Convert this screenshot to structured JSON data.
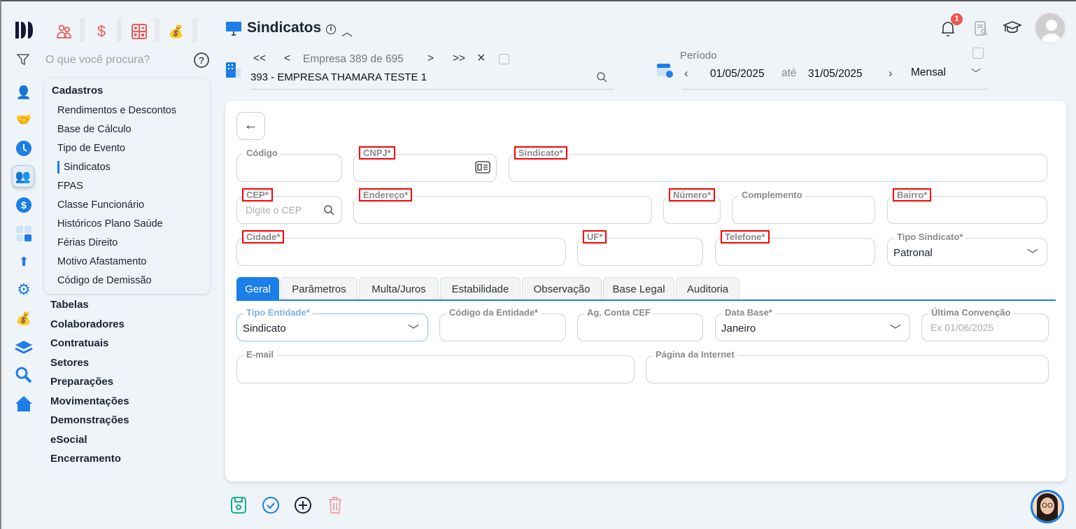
{
  "app": {
    "logo": "logo-mark"
  },
  "top_modules": [
    {
      "icon": "people-icon"
    },
    {
      "icon": "dollar-icon"
    },
    {
      "icon": "calculator-icon"
    },
    {
      "icon": "money-bag-icon"
    }
  ],
  "search": {
    "placeholder": "O que você procura?"
  },
  "page": {
    "title": "Sindicatos"
  },
  "company_nav": {
    "first": "<<",
    "prev": "<",
    "label": "Empresa 389 de 695",
    "next": ">",
    "last": ">>",
    "close": "×",
    "company": "393 - EMPRESA THAMARA TESTE 1"
  },
  "period": {
    "label": "Período",
    "start": "01/05/2025",
    "until": "até",
    "end": "31/05/2025",
    "type": "Mensal"
  },
  "notifications": {
    "count": "1"
  },
  "submenu": {
    "title": "Cadastros",
    "items": [
      "Rendimentos e Descontos",
      "Base de Cálculo",
      "Tipo de Evento",
      "Sindicatos",
      "FPAS",
      "Classe Funcionário",
      "Históricos Plano Saúde",
      "Férias Direito",
      "Motivo Afastamento",
      "Código de Demissão"
    ],
    "active": "Sindicatos"
  },
  "groups": [
    "Tabelas",
    "Colaboradores",
    "Contratuais",
    "Setores",
    "Preparações",
    "Movimentações",
    "Demonstrações",
    "eSocial",
    "Encerramento"
  ],
  "form": {
    "codigo": {
      "label": "Código",
      "value": ""
    },
    "cnpj": {
      "label": "CNPJ*",
      "value": ""
    },
    "sindicato": {
      "label": "Sindicato*",
      "value": ""
    },
    "cep": {
      "label": "CEP*",
      "placeholder": "Digite o CEP"
    },
    "endereco": {
      "label": "Endereço*",
      "value": ""
    },
    "numero": {
      "label": "Número*",
      "value": ""
    },
    "complemento": {
      "label": "Complemento",
      "value": ""
    },
    "bairro": {
      "label": "Bairro*",
      "value": ""
    },
    "cidade": {
      "label": "Cidade*",
      "value": ""
    },
    "uf": {
      "label": "UF*",
      "value": ""
    },
    "telefone": {
      "label": "Telefone*",
      "value": ""
    },
    "tipo_sindicato": {
      "label": "Tipo Sindicato*",
      "value": "Patronal"
    }
  },
  "tabs": [
    "Geral",
    "Parâmetros",
    "Multa/Juros",
    "Estabilidade",
    "Observação",
    "Base Legal",
    "Auditoria"
  ],
  "geral": {
    "tipo_entidade": {
      "label": "Tipo Entidade*",
      "value": "Sindicato"
    },
    "codigo_entidade": {
      "label": "Código da Entidade*",
      "value": ""
    },
    "ag_conta_cef": {
      "label": "Ag. Conta CEF",
      "value": ""
    },
    "data_base": {
      "label": "Data Base*",
      "value": "Janeiro"
    },
    "ultima_convencao": {
      "label": "Última Convenção",
      "placeholder": "Ex 01/06/2025"
    },
    "email": {
      "label": "E-mail",
      "value": ""
    },
    "pagina_internet": {
      "label": "Página da Internet",
      "value": ""
    }
  },
  "colors": {
    "accent": "#1a7fe8",
    "danger": "#f05a5a",
    "save": "#14b27f"
  }
}
